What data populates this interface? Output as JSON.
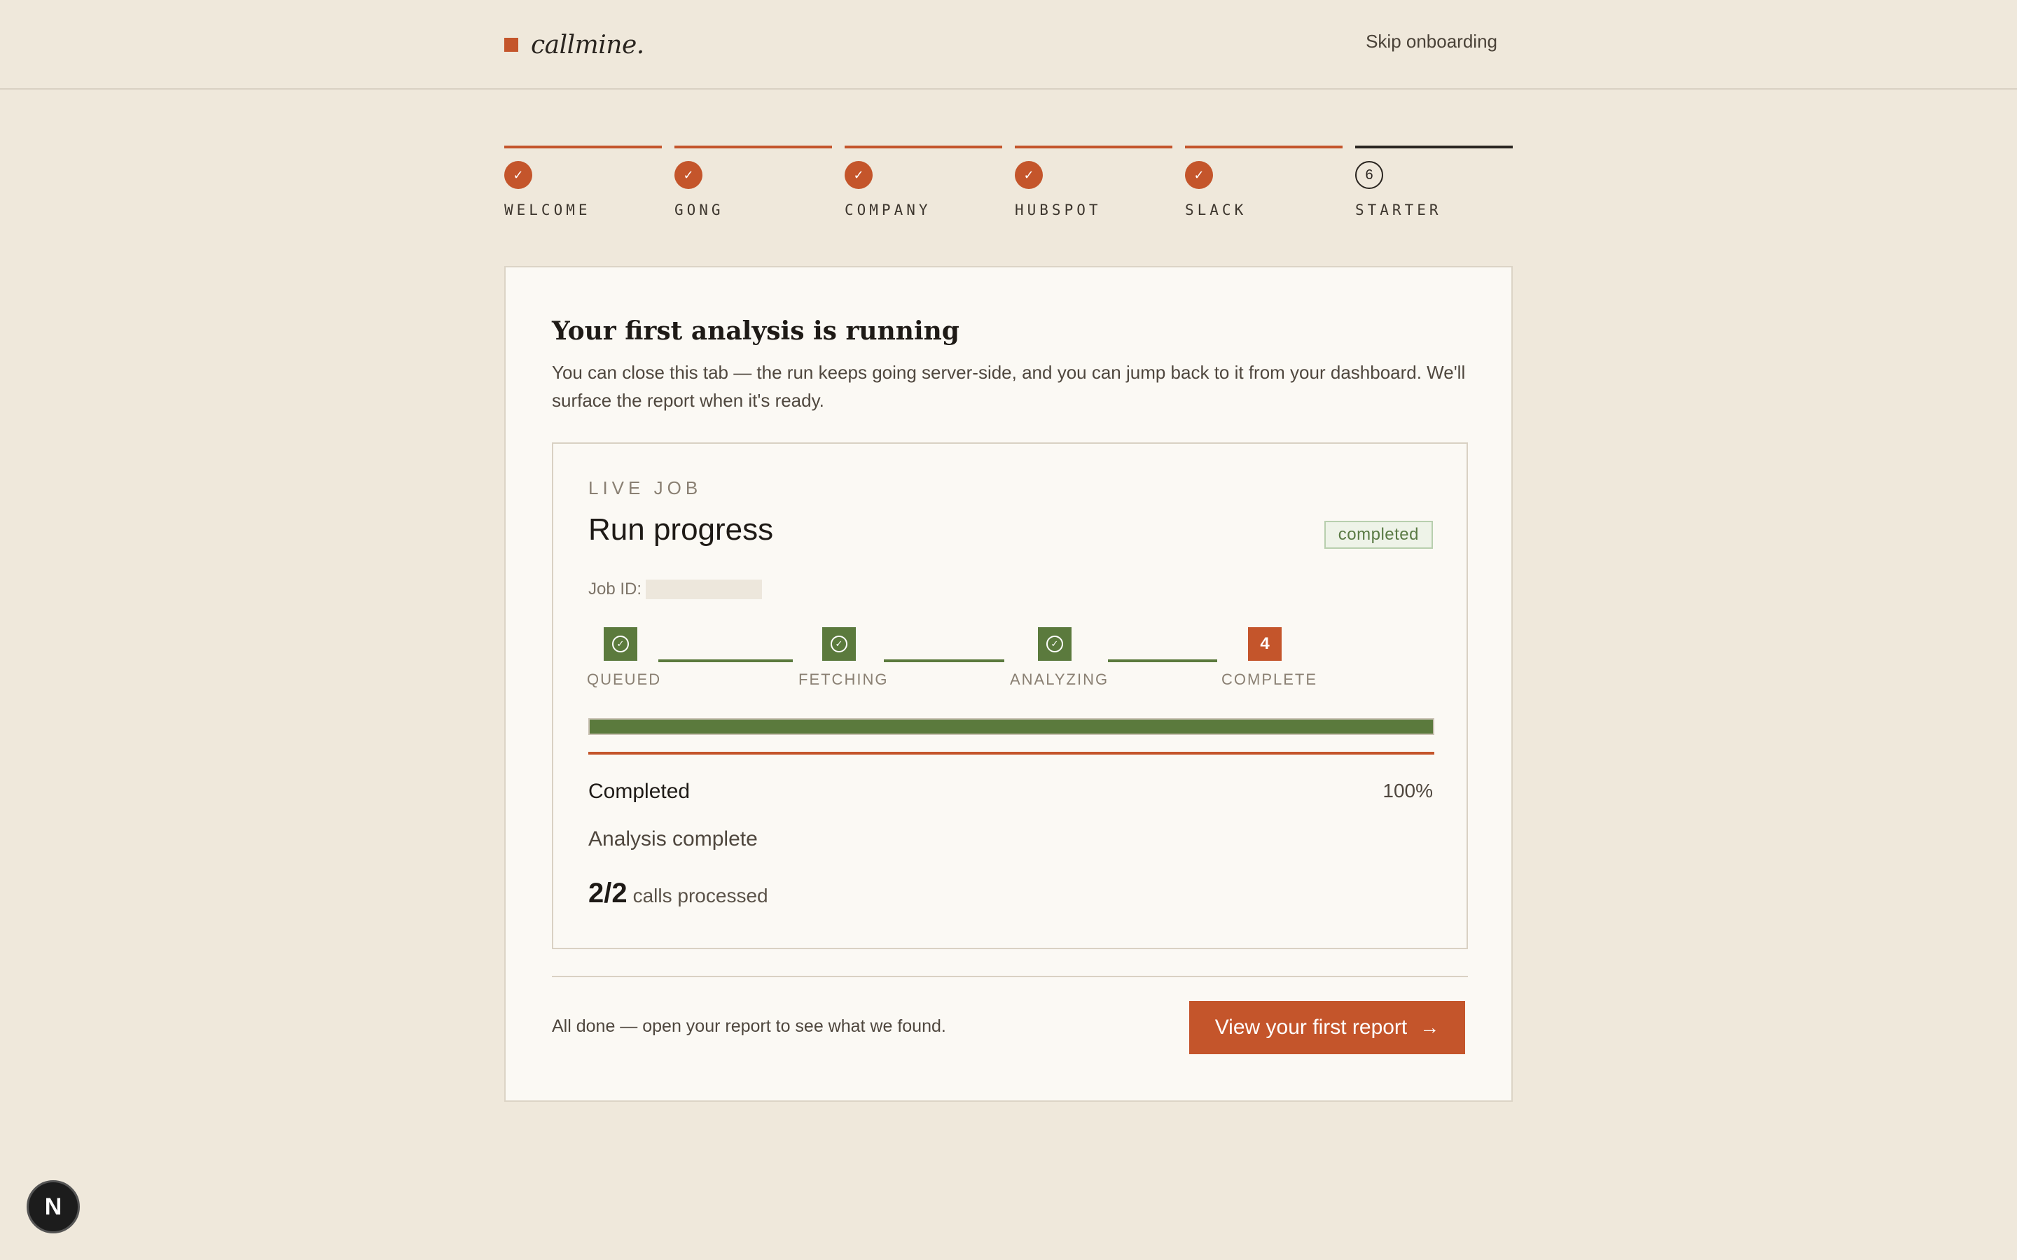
{
  "header": {
    "brand": "callmine.",
    "skip_label": "Skip onboarding"
  },
  "stepper": [
    {
      "label": "WELCOME",
      "done": true
    },
    {
      "label": "GONG",
      "done": true
    },
    {
      "label": "COMPANY",
      "done": true
    },
    {
      "label": "HUBSPOT",
      "done": true
    },
    {
      "label": "SLACK",
      "done": true
    },
    {
      "label": "STARTER",
      "done": false,
      "number": "6"
    }
  ],
  "card": {
    "title": "Your first analysis is running",
    "description": "You can close this tab — the run keeps going server-side, and you can jump back to it from your dashboard. We'll surface the report when it's ready.",
    "job": {
      "live_label": "LIVE JOB",
      "title": "Run progress",
      "status": "completed",
      "job_id_label": "Job ID:",
      "phases": [
        {
          "label": "QUEUED",
          "done": true
        },
        {
          "label": "FETCHING",
          "done": true
        },
        {
          "label": "ANALYZING",
          "done": true
        },
        {
          "label": "COMPLETE",
          "done": false,
          "number": "4"
        }
      ],
      "progress_percent": 100,
      "completed_label": "Completed",
      "percent_text": "100%",
      "message": "Analysis complete",
      "calls_count": "2/2",
      "calls_text": "calls processed"
    },
    "done_message": "All done — open your report to see what we found.",
    "cta_label": "View your first report"
  },
  "fab_label": "N",
  "colors": {
    "accent": "#c4552b",
    "success": "#5b7a3d",
    "background": "#efe8db"
  }
}
